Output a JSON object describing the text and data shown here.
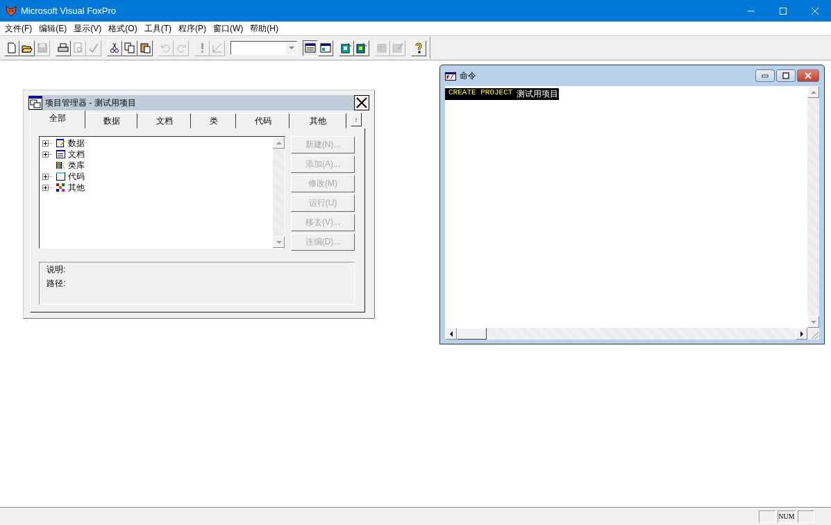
{
  "window": {
    "title": "Microsoft Visual FoxPro"
  },
  "menu": [
    "文件(F)",
    "编辑(E)",
    "显示(V)",
    "格式(O)",
    "工具(T)",
    "程序(P)",
    "窗口(W)",
    "帮助(H)"
  ],
  "toolbar": [
    [
      {
        "disabled": false
      },
      {
        "disabled": false
      },
      {
        "disabled": true
      }
    ],
    [
      {
        "disabled": false
      },
      {
        "disabled": true
      },
      {
        "disabled": true
      }
    ],
    [
      {
        "disabled": false
      },
      {
        "disabled": false
      },
      {
        "disabled": false
      }
    ],
    [
      {
        "disabled": true
      },
      {
        "disabled": true
      }
    ],
    [
      {
        "disabled": true
      },
      {
        "disabled": true
      }
    ],
    [
      {
        "disabled": false,
        "selected": true
      },
      {
        "disabled": false,
        "selected": false
      }
    ],
    [
      {
        "disabled": false
      },
      {
        "disabled": false
      }
    ],
    [
      {
        "disabled": true
      },
      {
        "disabled": true
      }
    ],
    [
      {
        "disabled": false
      }
    ]
  ],
  "project_manager": {
    "title": "项目管理器 - 测试用项目",
    "tabs": [
      {
        "label": "全部",
        "selected": true
      },
      {
        "label": "数据",
        "selected": false
      },
      {
        "label": "文档",
        "selected": false
      },
      {
        "label": "类",
        "selected": false
      },
      {
        "label": "代码",
        "selected": false
      },
      {
        "label": "其他",
        "selected": false
      }
    ],
    "collapse_button": "↑",
    "tree": [
      {
        "label": "数据",
        "kind": "folder"
      },
      {
        "label": "文档",
        "kind": "folder"
      },
      {
        "label": "类库",
        "kind": "leaf"
      },
      {
        "label": "代码",
        "kind": "folder"
      },
      {
        "label": "其他",
        "kind": "folder"
      }
    ],
    "buttons": [
      {
        "label": "新建(N)...",
        "disabled": true
      },
      {
        "label": "添加(A)...",
        "disabled": true
      },
      {
        "label": "修改(M)",
        "disabled": true
      },
      {
        "label": "运行(U)",
        "disabled": true
      },
      {
        "label": "移去(V)...",
        "disabled": true
      },
      {
        "label": "连编(D)...",
        "disabled": true
      }
    ],
    "info": [
      "说明:",
      "路径:"
    ]
  },
  "command_window": {
    "title": "命令",
    "lines": [
      {
        "keyword": "CREATE PROJECT",
        "argument": "测试用项目",
        "selected": true
      }
    ]
  },
  "status_bar": {
    "num_indicator": "NUM"
  }
}
